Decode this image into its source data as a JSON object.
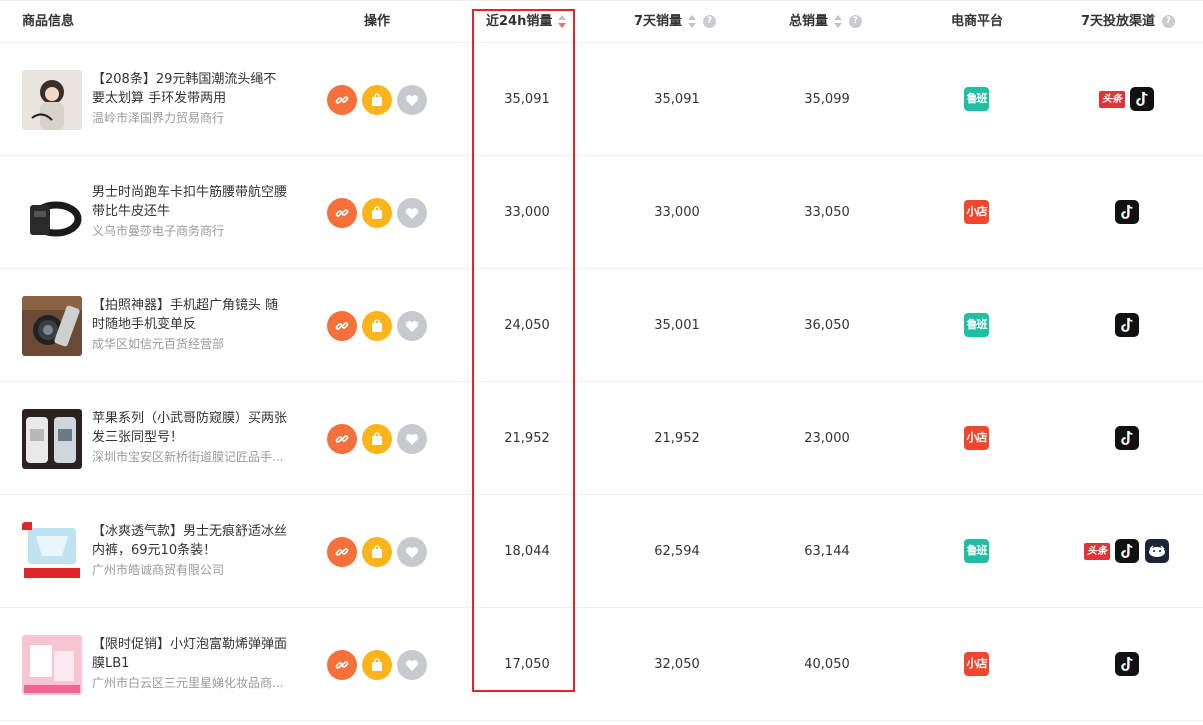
{
  "header": {
    "product": "商品信息",
    "action": "操作",
    "sales_24h": "近24h销量",
    "sales_7d": "7天销量",
    "sales_total": "总销量",
    "platform": "电商平台",
    "channels_7d": "7天投放渠道"
  },
  "colors": {
    "luban": "#1fbfa5",
    "xiaodian": "#f2462e",
    "sort_active": "#f56c6c",
    "highlight_box": "#e1252a"
  },
  "rows": [
    {
      "title": "【208条】29元韩国潮流头绳不要太划算 手环发带两用",
      "shop": "温岭市泽国界力贸易商行",
      "sales_24h": "35,091",
      "sales_7d": "35,091",
      "sales_total": "35,099",
      "platform": "鲁班",
      "channels": [
        "toutiao-icon",
        "douyin-icon"
      ],
      "channel_label": "头条"
    },
    {
      "title": "男士时尚跑车卡扣牛筋腰带航空腰带比牛皮还牛",
      "shop": "义乌市曼莎电子商务商行",
      "sales_24h": "33,000",
      "sales_7d": "33,000",
      "sales_total": "33,050",
      "platform": "小店",
      "channels": [
        "douyin-icon"
      ]
    },
    {
      "title": "【拍照神器】手机超广角镜头 随时随地手机变单反",
      "shop": "成华区如信元百货经营部",
      "sales_24h": "24,050",
      "sales_7d": "35,001",
      "sales_total": "36,050",
      "platform": "鲁班",
      "channels": [
        "douyin-icon"
      ]
    },
    {
      "title": "苹果系列（小武哥防窥膜）买两张发三张同型号！",
      "shop": "深圳市宝安区新桥街道膜记匠品手...",
      "sales_24h": "21,952",
      "sales_7d": "21,952",
      "sales_total": "23,000",
      "platform": "小店",
      "channels": [
        "douyin-icon"
      ]
    },
    {
      "title": "【冰爽透气款】男士无痕舒适冰丝内裤，69元10条装！",
      "shop": "广州市皓诚商贸有限公司",
      "sales_24h": "18,044",
      "sales_7d": "62,594",
      "sales_total": "63,144",
      "platform": "鲁班",
      "channels": [
        "toutiao-icon",
        "douyin-icon",
        "xigua-icon"
      ],
      "channel_label": "头条"
    },
    {
      "title": "【限时促销】小灯泡富勒烯弹弹面膜LB1",
      "shop": "广州市白云区三元里星娣化妆品商...",
      "sales_24h": "17,050",
      "sales_7d": "32,050",
      "sales_total": "40,050",
      "platform": "小店",
      "channels": [
        "douyin-icon"
      ]
    }
  ]
}
